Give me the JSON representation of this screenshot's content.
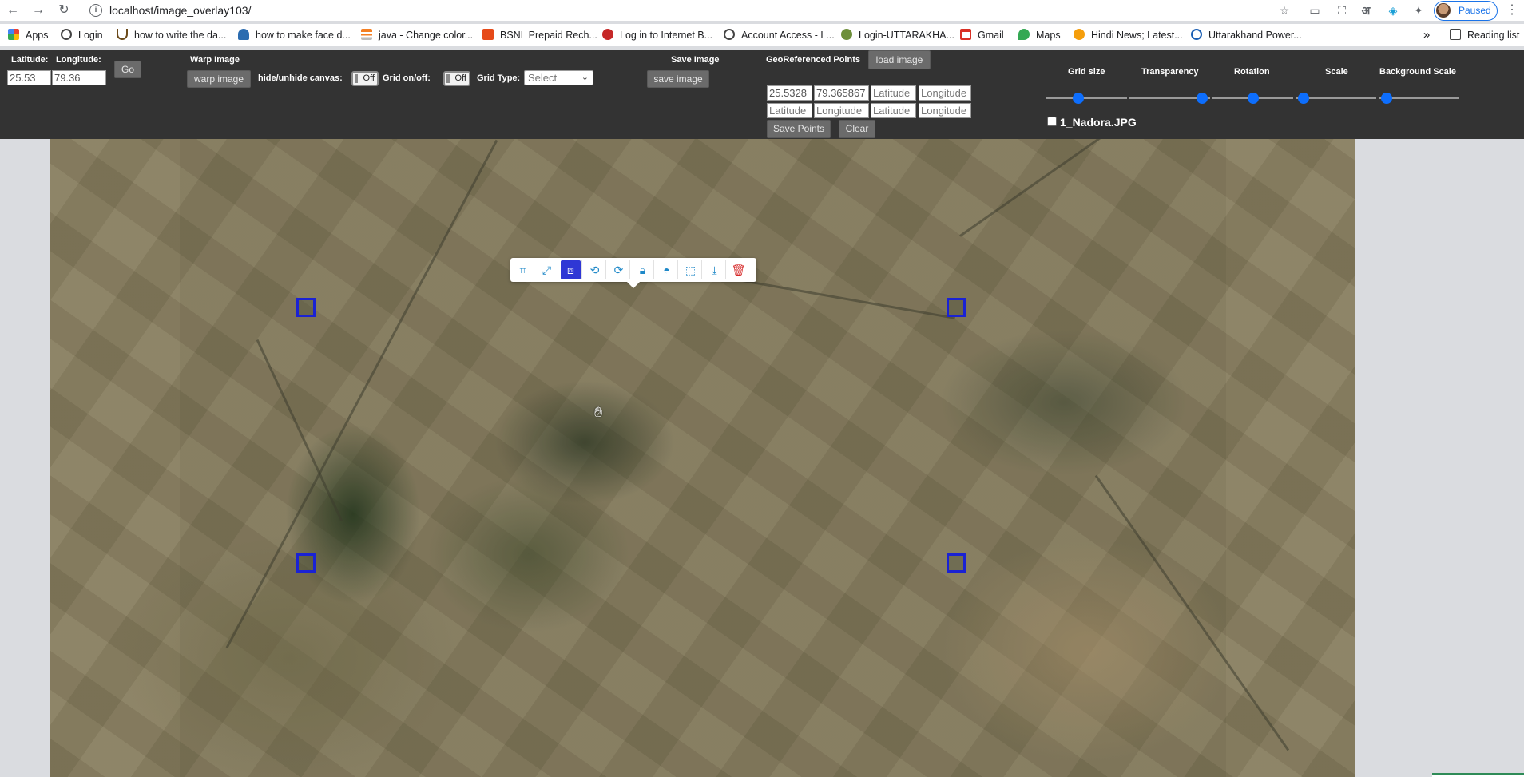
{
  "browser": {
    "url": "localhost/image_overlay103/",
    "profile_status": "Paused",
    "lang_icon_text": "अ",
    "bookmarks": [
      "Apps",
      "Login",
      "how to write the da...",
      "how to make face d...",
      "java - Change color...",
      "BSNL Prepaid Rech...",
      "Log in to Internet B...",
      "Account Access - L...",
      "Login-UTTARAKHA...",
      "Gmail",
      "Maps",
      "Hindi News; Latest...",
      "Uttarakhand Power..."
    ],
    "bookmarks_overflow": "»",
    "reading_list": "Reading list"
  },
  "toolbar": {
    "latitude_label": "Latitude:",
    "longitude_label": "Longitude:",
    "latitude_value": "25.53",
    "longitude_value": "79.36",
    "go_label": "Go",
    "warp_section": "Warp Image",
    "warp_button": "warp image",
    "hide_canvas_label": "hide/unhide canvas:",
    "hide_canvas_state": "Off",
    "grid_label": "Grid on/off:",
    "grid_state": "Off",
    "grid_type_label": "Grid Type:",
    "grid_type_value": "Select",
    "save_section": "Save Image",
    "save_button": "save image",
    "geo_section": "GeoReferenced Points",
    "load_button": "load image",
    "points": {
      "lat1": "25.5328",
      "lon1": "79.365867",
      "lat2_placeholder": "Latitude",
      "lon2_placeholder": "Longitude",
      "lat3_placeholder": "Latitude",
      "lon3_placeholder": "Longitude",
      "lat4_placeholder": "Latitude",
      "lon4_placeholder": "Longitude"
    },
    "save_points_button": "Save Points",
    "clear_button": "Clear",
    "sliders": [
      {
        "label": "Grid size",
        "level": 0.4
      },
      {
        "label": "Transparency",
        "level": 0.9
      },
      {
        "label": "Rotation",
        "level": 0.5
      },
      {
        "label": "Scale",
        "level": 0.1
      },
      {
        "label": "Background Scale",
        "level": 0.1
      }
    ],
    "layer_file": "1_Nadora.JPG"
  },
  "map": {
    "edit_tools": [
      "distort-icon",
      "scale-icon",
      "free-rotate-icon",
      "rotate-icon",
      "restore-icon",
      "lock-icon",
      "opacity-icon",
      "border-icon",
      "export-icon",
      "delete-icon"
    ],
    "active_tool": "free-rotate-icon"
  },
  "colors": {
    "toolbar_bg": "#333333",
    "slider_thumb": "#0d6efd",
    "gcp_marker": "#1a22d4",
    "edit_active": "#2f37d5",
    "delete": "#d62828"
  }
}
